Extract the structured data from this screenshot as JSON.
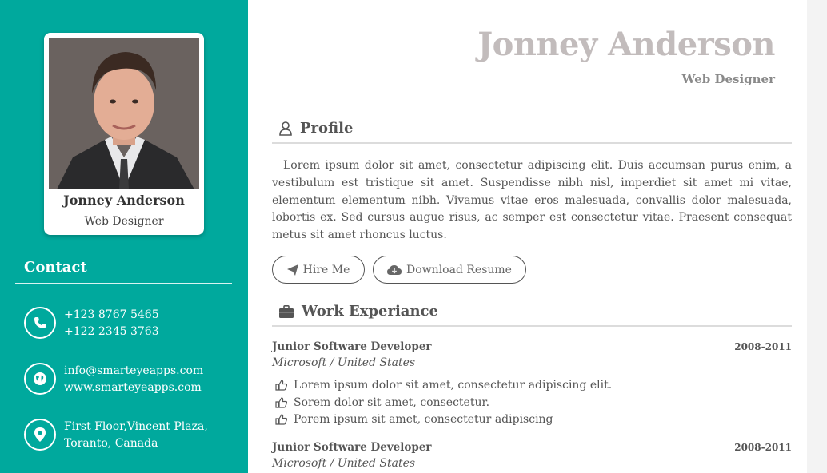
{
  "sidebar": {
    "card": {
      "name": "Jonney Anderson",
      "role": "Web Designer"
    },
    "contact_title": "Contact",
    "contacts": [
      {
        "icon": "phone-icon",
        "lines": [
          "+123 8767 5465",
          "+122 2345 3763"
        ]
      },
      {
        "icon": "globe-icon",
        "lines": [
          "info@smarteyeapps.com",
          "www.smarteyeapps.com"
        ]
      },
      {
        "icon": "map-pin-icon",
        "lines": [
          "First Floor,Vincent Plaza,",
          "Toranto, Canada"
        ]
      }
    ]
  },
  "header": {
    "name": "Jonney Anderson",
    "role": "Web Designer"
  },
  "profile": {
    "title": "Profile",
    "text": "Lorem ipsum dolor sit amet, consectetur adipiscing elit. Duis accumsan purus enim, a vestibulum est tristique sit amet. Suspendisse nibh nisl, imperdiet sit amet mi vitae, elementum elementum nibh. Vivamus vitae eros malesuada, convallis dolor malesuada, lobortis ex. Sed cursus augue risus, ac semper est consectetur vitae. Praesent consequat metus sit amet rhoncus luctus.",
    "hire_label": "Hire Me",
    "download_label": "Download Resume"
  },
  "work": {
    "title": "Work Experiance",
    "jobs": [
      {
        "title": "Junior Software Developer",
        "years": "2008-2011",
        "company": "Microsoft / United States",
        "points": [
          "Lorem ipsum dolor sit amet, consectetur adipiscing elit.",
          "Sorem dolor sit amet, consectetur.",
          "Porem ipsum sit amet, consectetur adipiscing"
        ]
      },
      {
        "title": "Junior Software Developer",
        "years": "2008-2011",
        "company": "Microsoft / United States"
      }
    ]
  },
  "colors": {
    "accent": "#00a99d",
    "hero_name": "#c2bcbc"
  }
}
